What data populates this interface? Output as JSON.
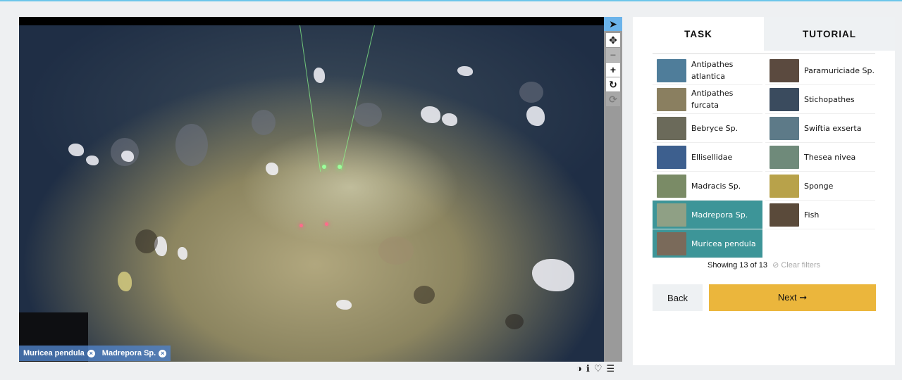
{
  "viewer": {
    "subject_tags": [
      {
        "label": "Muricea pendula"
      },
      {
        "label": "Madrepora Sp."
      }
    ],
    "toolbar": {
      "pointer_icon": "pointer-arrow-icon",
      "move_icon": "move-cross-icon",
      "zoom_out_icon": "minus-icon",
      "zoom_in_icon": "plus-icon",
      "rotate_icon": "rotate-icon",
      "reset_icon": "reset-icon",
      "pointer_glyph": "➤",
      "move_glyph": "✥",
      "zoom_out_glyph": "−",
      "zoom_in_glyph": "+",
      "rotate_glyph": "↻",
      "reset_glyph": "⟳"
    },
    "bottom_icons": {
      "contrast_glyph": "◑",
      "info_glyph": "ℹ",
      "favorite_glyph": "♡",
      "collections_glyph": "☰"
    }
  },
  "panel": {
    "tabs": [
      {
        "label": "TASK",
        "active": true
      },
      {
        "label": "TUTORIAL",
        "active": false
      }
    ],
    "choices": [
      {
        "label": "Antipathes atlantica",
        "selected": false,
        "thumb_color": "#4f7d9a"
      },
      {
        "label": "Paramuriciade Sp.",
        "selected": false,
        "thumb_color": "#5b4a3f"
      },
      {
        "label": "Antipathes furcata",
        "selected": false,
        "thumb_color": "#8a7f60"
      },
      {
        "label": "Stichopathes",
        "selected": false,
        "thumb_color": "#3a4b5e"
      },
      {
        "label": "Bebryce Sp.",
        "selected": false,
        "thumb_color": "#6b6a5a"
      },
      {
        "label": "Swiftia exserta",
        "selected": false,
        "thumb_color": "#5d7a88"
      },
      {
        "label": "Ellisellidae",
        "selected": false,
        "thumb_color": "#3d5f8e"
      },
      {
        "label": "Thesea nivea",
        "selected": false,
        "thumb_color": "#6f8a7a"
      },
      {
        "label": "Madracis Sp.",
        "selected": false,
        "thumb_color": "#7a8b66"
      },
      {
        "label": "Sponge",
        "selected": false,
        "thumb_color": "#b8a24a"
      },
      {
        "label": "Madrepora Sp.",
        "selected": true,
        "thumb_color": "#8fa085"
      },
      {
        "label": "Fish",
        "selected": false,
        "thumb_color": "#5a4a3a"
      },
      {
        "label": "Muricea pendula",
        "selected": true,
        "thumb_color": "#7a6a5a"
      }
    ],
    "showing_text": "Showing 13 of 13",
    "clear_filters": "Clear filters",
    "clear_icon": "⊘",
    "back_label": "Back",
    "next_label": "Next ➞"
  }
}
